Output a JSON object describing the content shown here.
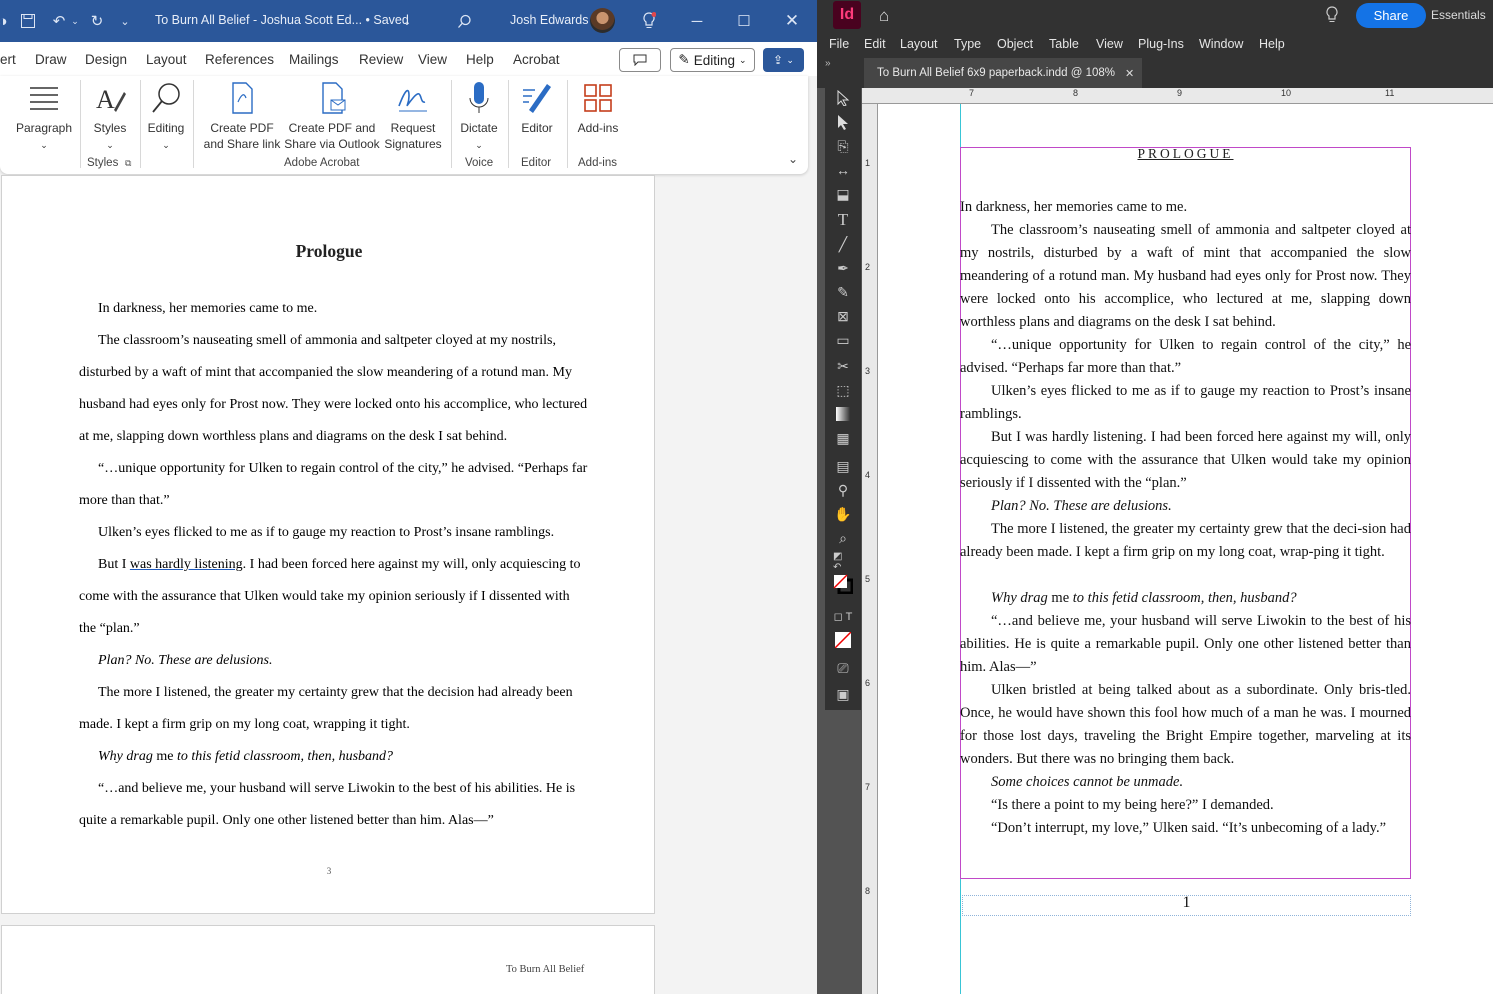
{
  "word": {
    "title_bar": {
      "doc_title": "To Burn All Belief - Joshua Scott Ed... • Saved",
      "user": "Josh Edwards"
    },
    "menu_tabs": [
      "ert",
      "Draw",
      "Design",
      "Layout",
      "References",
      "Mailings",
      "Review",
      "View",
      "Help",
      "Acrobat"
    ],
    "editing_label": "Editing",
    "ribbon": {
      "paragraph": "Paragraph",
      "styles": "Styles",
      "editing": "Editing",
      "create_pdf_1": "Create PDF",
      "create_pdf_2": "and Share link",
      "create_pdf_outlook_1": "Create PDF and",
      "create_pdf_outlook_2": "Share via Outlook",
      "request_sig_1": "Request",
      "request_sig_2": "Signatures",
      "dictate": "Dictate",
      "editor": "Editor",
      "addins": "Add-ins",
      "group_styles": "Styles",
      "group_acrobat": "Adobe Acrobat",
      "group_voice": "Voice",
      "group_editor": "Editor",
      "group_addins": "Add-ins"
    },
    "page": {
      "heading": "Prologue",
      "p1": "In darkness, her memories came to me.",
      "p2": "The classroom’s nauseating smell of ammonia and saltpeter cloyed at my nostrils, disturbed by a waft of mint that accompanied the slow meandering of a rotund man. My husband had eyes only for Prost now. They were locked onto his accomplice, who lectured at me, slapping down worthless plans and diagrams on the desk I sat behind.",
      "p3": "“…unique opportunity for Ulken to regain control of the city,” he advised. “Perhaps far more than that.”",
      "p4": "Ulken’s eyes flicked to me as if to gauge my reaction to Prost’s insane ramblings.",
      "p5_a": "But I ",
      "p5_ul": "was hardly listening",
      "p5_b": ". I had been forced here against my will, only acquiescing to come with the assurance that Ulken would take my opinion seriously if I dissented with the “plan.”",
      "p6": "Plan? No. These are delusions.",
      "p7": "The more I listened, the greater my certainty grew that the decision had already been made. I kept a firm grip on my long coat, wrapping it tight.",
      "p8_a": "Why drag ",
      "p8_b": "me",
      "p8_c": " to this fetid classroom, then, husband?",
      "p9": "“…and believe me, your husband will serve Liwokin to the best of his abilities. He is quite a remarkable pupil. Only one other listened better than him. Alas—”",
      "page_number": "3",
      "next_header": "To Burn All Belief"
    }
  },
  "indesign": {
    "logo": "Id",
    "share": "Share",
    "workspace": "Essentials",
    "menu": [
      "File",
      "Edit",
      "Layout",
      "Type",
      "Object",
      "Table",
      "View",
      "Plug-Ins",
      "Window",
      "Help"
    ],
    "doc_tab": "To Burn All Belief 6x9 paperback.indd @ 108%",
    "ruler_top": [
      "7",
      "8",
      "9",
      "10",
      "11"
    ],
    "ruler_left": [
      "1",
      "2",
      "3",
      "4",
      "5",
      "6",
      "7",
      "8"
    ],
    "page": {
      "title": "PROLOGUE",
      "p1": "In darkness, her memories came to me.",
      "p2": "The classroom’s nauseating smell of ammonia and saltpeter cloyed at my nostrils, disturbed by a waft of mint that accompanied the slow meandering of a rotund man. My husband had eyes only for Prost now. They were locked onto his accomplice, who lectured at me, slapping down worthless plans and diagrams on the desk I sat behind.",
      "p3": "“…unique opportunity for Ulken to regain control of the city,” he advised. “Perhaps far more than that.”",
      "p4": "Ulken’s eyes flicked to me as if to gauge my reaction to Prost’s insane ramblings.",
      "p5": "But I was hardly listening. I had been forced here against my will, only acquiescing to come with the assurance that Ulken would take my opinion seriously if I dissented with the “plan.”",
      "p6": "Plan? No. These are delusions.",
      "p7": "The more I listened, the greater my certainty grew that the deci-sion had already been made. I kept a firm grip on my long coat, wrap-ping it tight.",
      "p8_a": "Why drag ",
      "p8_b": "me",
      "p8_c": " to this fetid classroom, then, husband?",
      "p9": "“…and believe me, your husband will serve Liwokin to the best of his abilities. He is quite a remarkable pupil. Only one other listened better than him. Alas—”",
      "p10": "Ulken bristled at being talked about as a subordinate. Only bris-tled. Once, he would have shown this fool how much of a man he was. I mourned for those lost days, traveling the Bright Empire together, marveling at its wonders. But there was no bringing them back.",
      "p11": "Some choices cannot be unmade.",
      "p12": "“Is there a point to my being here?” I demanded.",
      "p13": "“Don’t interrupt, my love,” Ulken said. “It’s unbecoming of a lady.”",
      "folio": "1"
    }
  }
}
